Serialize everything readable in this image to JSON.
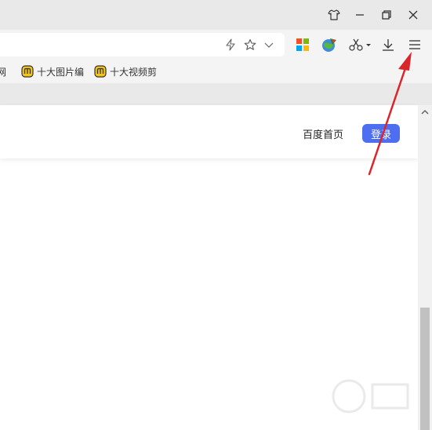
{
  "bookmarks": [
    {
      "label": "网"
    },
    {
      "label": "十大图片编"
    },
    {
      "label": "十大视频剪"
    }
  ],
  "page": {
    "home_link": "百度首页",
    "login_label": "登录"
  },
  "colors": {
    "login": "#4e6ef2",
    "annotation_arrow": "#d9262b"
  },
  "icons": {
    "window": [
      "skin-icon",
      "minimize-icon",
      "restore-icon",
      "close-icon"
    ],
    "address": [
      "lightning-icon",
      "star-icon",
      "chevron-down-icon"
    ],
    "toolbar": [
      "apps-grid-icon",
      "globe-icon",
      "scissors-icon",
      "download-icon",
      "menu-icon"
    ]
  }
}
